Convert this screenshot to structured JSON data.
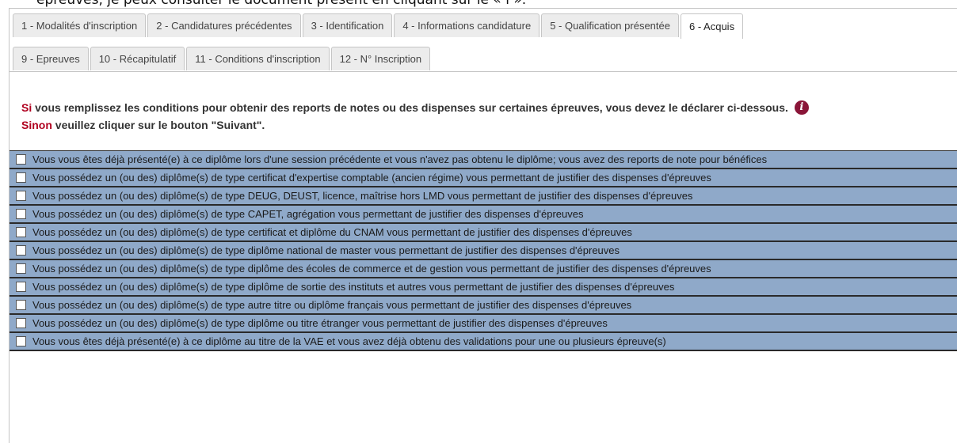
{
  "caption": "épreuves, je peux consulter le document présent en cliquant sur le « i ».",
  "tabs_row1": [
    {
      "label": "1 - Modalités d'inscription",
      "active": false
    },
    {
      "label": "2 - Candidatures précédentes",
      "active": false
    },
    {
      "label": "3 - Identification",
      "active": false
    },
    {
      "label": "4 - Informations candidature",
      "active": false
    },
    {
      "label": "5 - Qualification présentée",
      "active": false
    },
    {
      "label": "6 - Acquis",
      "active": true
    }
  ],
  "tabs_row2": [
    {
      "label": "9 - Epreuves"
    },
    {
      "label": "10 - Récapitulatif"
    },
    {
      "label": "11 - Conditions d'inscription"
    },
    {
      "label": "12 - N° Inscription"
    }
  ],
  "intro": {
    "si": "Si",
    "line1_rest": " vous remplissez les conditions pour obtenir des reports de notes ou des dispenses sur certaines épreuves, vous devez le déclarer ci-dessous.",
    "sinon": "Sinon",
    "line2_rest": " veuillez cliquer sur le bouton \"Suivant\".",
    "info_glyph": "i"
  },
  "options": [
    "Vous vous êtes déjà présenté(e) à ce diplôme lors d'une session précédente et vous n'avez pas obtenu le diplôme; vous avez des reports de note pour bénéfices",
    "Vous possédez un (ou des) diplôme(s) de type certificat d'expertise comptable (ancien régime) vous permettant de justifier des dispenses d'épreuves",
    "Vous possédez un (ou des) diplôme(s) de type DEUG, DEUST, licence, maîtrise hors LMD vous permettant de justifier des dispenses d'épreuves",
    "Vous possédez un (ou des) diplôme(s) de type CAPET, agrégation vous permettant de justifier des dispenses d'épreuves",
    "Vous possédez un (ou des) diplôme(s) de type certificat et diplôme du CNAM vous permettant de justifier des dispenses d'épreuves",
    "Vous possédez un (ou des) diplôme(s) de type diplôme national de master vous permettant de justifier des dispenses d'épreuves",
    "Vous possédez un (ou des) diplôme(s) de type diplôme des écoles de commerce et de gestion vous permettant de justifier des dispenses d'épreuves",
    "Vous possédez un (ou des) diplôme(s) de type diplôme de sortie des instituts et autres vous permettant de justifier des dispenses d'épreuves",
    "Vous possédez un (ou des) diplôme(s) de type autre titre ou diplôme français vous permettant de justifier des dispenses d'épreuves",
    "Vous possédez un (ou des) diplôme(s) de type diplôme ou titre étranger vous permettant de justifier des dispenses d'épreuves",
    "Vous vous êtes déjà présenté(e) à ce diplôme au titre de la VAE et vous avez déjà obtenu des validations pour une ou plusieurs épreuve(s)"
  ],
  "colors": {
    "row_bg": "#8fa9c9",
    "accent_red": "#b0001f",
    "info_icon": "#8a1538"
  }
}
